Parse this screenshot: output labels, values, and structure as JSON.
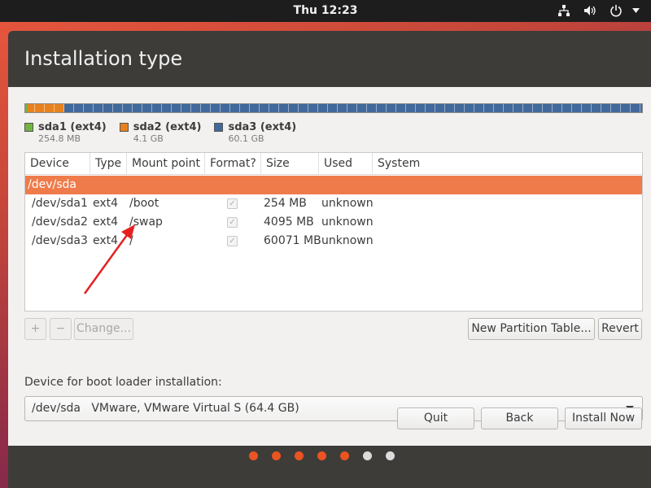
{
  "topbar": {
    "clock": "Thu 12:23",
    "icons": [
      "network-icon",
      "volume-icon",
      "power-icon"
    ]
  },
  "window": {
    "title": "Installation type"
  },
  "partition_bar": {
    "segments": [
      {
        "name": "sda1 (ext4)",
        "size": "254.8 MB",
        "color": "#73b342"
      },
      {
        "name": "sda2 (ext4)",
        "size": "4.1 GB",
        "color": "#e8821f"
      },
      {
        "name": "sda3 (ext4)",
        "size": "60.1 GB",
        "color": "#41699c"
      }
    ]
  },
  "table": {
    "headers": [
      "Device",
      "Type",
      "Mount point",
      "Format?",
      "Size",
      "Used",
      "System"
    ],
    "disk_row": "/dev/sda",
    "rows": [
      {
        "device": "/dev/sda1",
        "type": "ext4",
        "mount": "/boot",
        "format": true,
        "size": "254 MB",
        "used": "unknown"
      },
      {
        "device": "/dev/sda2",
        "type": "ext4",
        "mount": "/swap",
        "format": true,
        "size": "4095 MB",
        "used": "unknown"
      },
      {
        "device": "/dev/sda3",
        "type": "ext4",
        "mount": "/",
        "format": true,
        "size": "60071 MB",
        "used": "unknown"
      }
    ]
  },
  "actions": {
    "add": "+",
    "remove": "−",
    "change": "Change...",
    "new_table": "New Partition Table...",
    "revert": "Revert"
  },
  "bootloader": {
    "label": "Device for boot loader installation:",
    "value": "/dev/sda   VMware, VMware Virtual S (64.4 GB)"
  },
  "footer": {
    "quit": "Quit",
    "back": "Back",
    "install": "Install Now"
  },
  "progress": {
    "total_steps": 7,
    "completed_steps": 5,
    "active_color": "#e95420",
    "inactive_color": "#dcdcdc"
  },
  "annotation": {
    "color": "#e5201f"
  }
}
